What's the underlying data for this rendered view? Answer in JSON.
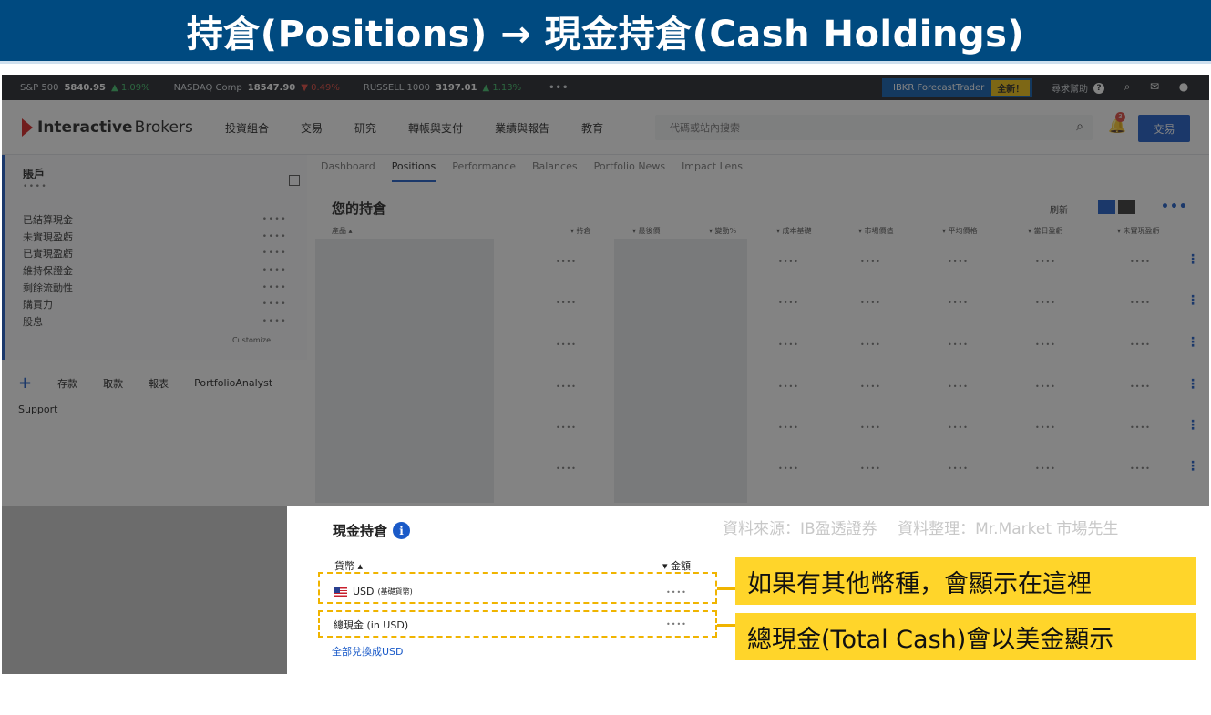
{
  "banner": {
    "title": "持倉(Positions) → 現金持倉(Cash Holdings)"
  },
  "ticker": {
    "items": [
      {
        "name": "S&P 500",
        "value": "5840.95",
        "change": "▲ 1.09%",
        "direction": "up"
      },
      {
        "name": "NASDAQ Comp",
        "value": "18547.90",
        "change": "▼ 0.49%",
        "direction": "down"
      },
      {
        "name": "RUSSELL 1000",
        "value": "3197.01",
        "change": "▲ 1.13%",
        "direction": "up"
      }
    ],
    "more": "•••",
    "forecast_trader": "IBKR ForecastTrader",
    "new_badge": "全新！",
    "help": "尋求幫助",
    "help_icon": "question-icon",
    "search_icon": "search-icon",
    "mail_icon": "mail-icon",
    "user_icon": "user-icon"
  },
  "nav": {
    "logo_a": "Interactive",
    "logo_b": "Brokers",
    "links": [
      "投資組合",
      "交易",
      "研究",
      "轉帳與支付",
      "業績與報告",
      "教育"
    ],
    "search_placeholder": "代碼或站內搜索",
    "notification_count": "3",
    "trade_button": "交易"
  },
  "sidebar": {
    "account_title": "賬戶",
    "masked": "••••",
    "items": [
      "已結算現金",
      "未實現盈虧",
      "已實現盈虧",
      "維持保證金",
      "剩餘流動性",
      "購買力",
      "股息"
    ],
    "customize": "Customize",
    "quick_actions": [
      "存款",
      "取款",
      "報表",
      "PortfolioAnalyst"
    ],
    "support": "Support"
  },
  "main": {
    "tabs": [
      "Dashboard",
      "Positions",
      "Performance",
      "Balances",
      "Portfolio News",
      "Impact Lens"
    ],
    "active_tab": "Positions",
    "heading": "您的持倉",
    "refresh": "刷新",
    "columns": [
      "產品 ▴",
      "▾ 持倉",
      "▾ 最後價",
      "▾ 變動%",
      "▾ 成本基礎",
      "▾ 市場價值",
      "▾ 平均價格",
      "▾ 當日盈虧",
      "▾ 未實現盈虧"
    ]
  },
  "cash": {
    "title": "現金持倉",
    "source": "資料來源：IB盈透證券　 資料整理：Mr.Market 市場先生",
    "col_currency": "貨幣 ▴",
    "col_amount": "▾ 金額",
    "row1_label": "USD",
    "row1_sub": "(基礎貨幣)",
    "row2_label": "總現金 (in USD)",
    "masked": "••••",
    "convert_link": "全部兌換成USD"
  },
  "callouts": {
    "other_currencies": "如果有其他幣種，會顯示在這裡",
    "total_cash": "總現金(Total Cash)會以美金顯示"
  },
  "colors": {
    "banner": "#004a80",
    "callout": "#ffd52a",
    "accent": "#1a5ac8"
  }
}
